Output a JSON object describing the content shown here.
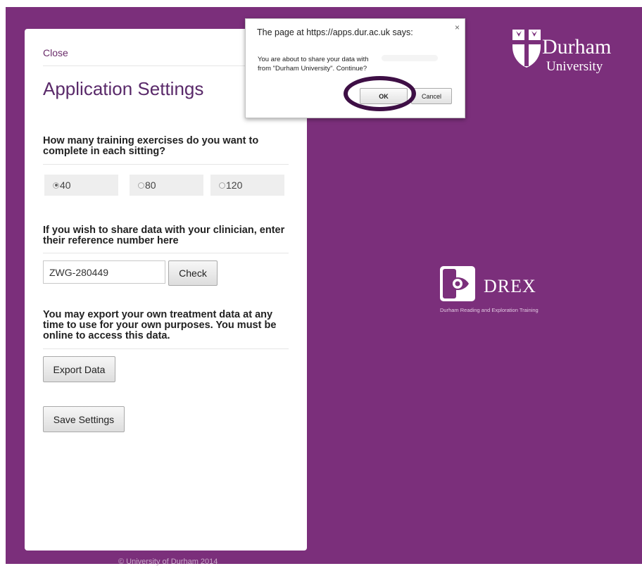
{
  "colors": {
    "brand_purple": "#7b2f7b",
    "title_purple": "#5a2a6a",
    "ring": "#3e0f45"
  },
  "panel": {
    "close_label": "Close",
    "title": "Application Settings",
    "exercises": {
      "heading": "How many training exercises do you want to complete in each sitting?",
      "options": [
        "40",
        "80",
        "120"
      ],
      "selected": "40"
    },
    "clinician": {
      "heading": "If you wish to share data with your clinician, enter their reference number here",
      "reference_value": "ZWG-280449",
      "check_label": "Check"
    },
    "export": {
      "heading": "You may export your own treatment data at any time to use for your own purposes. You must be online to access this data.",
      "button_label": "Export Data"
    },
    "save_label": "Save Settings"
  },
  "footer": {
    "text": "© University of Durham 2014"
  },
  "durham_logo": {
    "name": "Durham",
    "subtitle": "University"
  },
  "drex_logo": {
    "name": "DREX",
    "tagline": "Durham Reading and Exploration Training"
  },
  "dialog": {
    "title": "The page at https://apps.dur.ac.uk says:",
    "message_line1": "You are about to share your data with",
    "message_line2": "from \"Durham University\". Continue?",
    "ok_label": "OK",
    "cancel_label": "Cancel",
    "close_symbol": "×"
  }
}
